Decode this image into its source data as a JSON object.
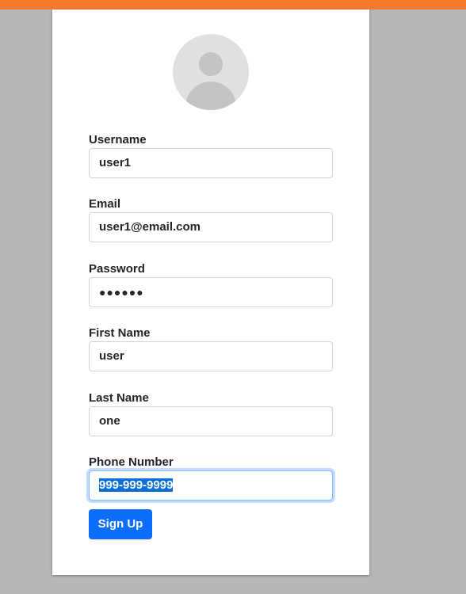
{
  "colors": {
    "background": "#b6b6b6",
    "top_bar": "#f47a2b",
    "card": "#ffffff",
    "primary_button": "#0d6efd",
    "selection": "#0a6fd8"
  },
  "avatar": {
    "icon": "user-avatar-icon"
  },
  "form": {
    "username": {
      "label": "Username",
      "value": "user1"
    },
    "email": {
      "label": "Email",
      "value": "user1@email.com"
    },
    "password": {
      "label": "Password",
      "value": "●●●●●●"
    },
    "first_name": {
      "label": "First Name",
      "value": "user"
    },
    "last_name": {
      "label": "Last Name",
      "value": "one"
    },
    "phone_number": {
      "label": "Phone Number",
      "value": "999-999-9999"
    }
  },
  "signup_button": {
    "label": "Sign Up"
  }
}
